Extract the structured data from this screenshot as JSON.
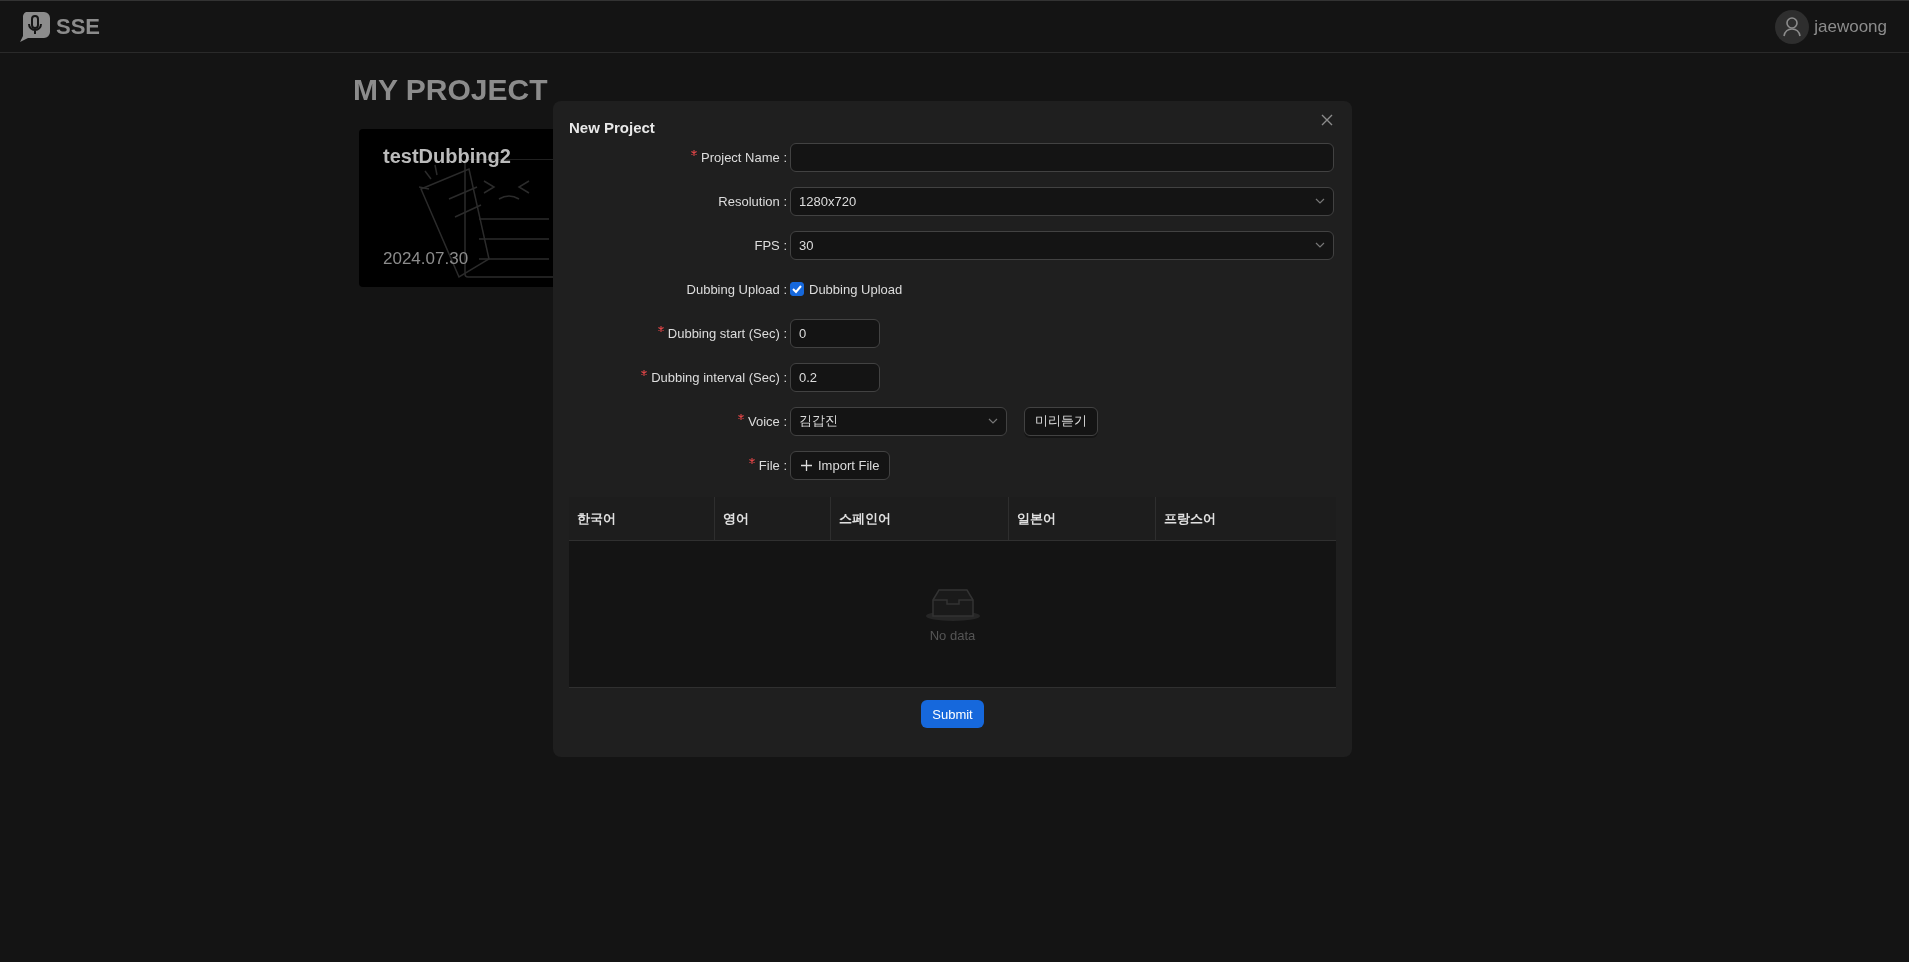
{
  "header": {
    "logo": "SSE",
    "user": "jaewoong"
  },
  "page": {
    "title": "MY PROJECT",
    "projects": [
      {
        "name": "testDubbing2",
        "date": "2024.07.30"
      }
    ]
  },
  "modal": {
    "title": "New Project",
    "fields": [
      {
        "kind": "text",
        "label": "Project Name :",
        "required": true
      },
      {
        "kind": "select",
        "label": "Resolution :",
        "required": false,
        "value": "1280x720"
      },
      {
        "kind": "select",
        "label": "FPS :",
        "required": false,
        "value": "30"
      },
      {
        "kind": "checkbox",
        "label": "Dubbing Upload :",
        "required": false,
        "checked": true,
        "text": "Dubbing Upload"
      },
      {
        "kind": "number",
        "label": "Dubbing start (Sec) :",
        "required": true,
        "value": "0"
      },
      {
        "kind": "number",
        "label": "Dubbing interval (Sec) :",
        "required": true,
        "value": "0.2"
      },
      {
        "kind": "voice",
        "label": "Voice :",
        "required": true,
        "value": "김갑진",
        "button": "미리듣기"
      },
      {
        "kind": "file",
        "label": "File :",
        "required": true,
        "button": "Import File"
      }
    ],
    "table": {
      "columns": [
        "한국어",
        "영어",
        "스페인어",
        "일본어",
        "프랑스어"
      ],
      "empty": "No data"
    },
    "submit": "Submit"
  }
}
